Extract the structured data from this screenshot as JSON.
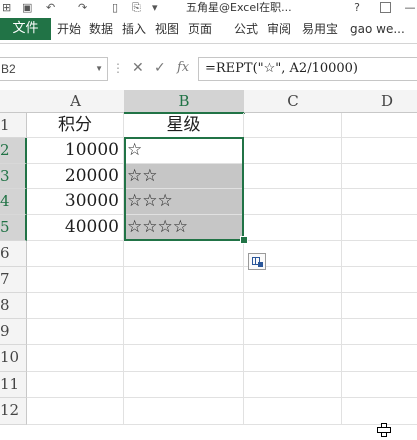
{
  "window": {
    "title": "五角星@Excel在职...",
    "help": "?",
    "restore": "⊡",
    "minimize": "—"
  },
  "ribbon": {
    "file_tab": "文件",
    "tabs": [
      "开始",
      "数据",
      "插入",
      "视图",
      "页面",
      "公式",
      "审阅",
      "易用宝",
      "gao we..."
    ]
  },
  "formula_bar": {
    "name_box": "B2",
    "formula": "=REPT(\"☆\", A2/10000)",
    "cancel_icon": "✕",
    "confirm_icon": "✓",
    "fx_icon": "fx"
  },
  "sheet": {
    "columns": [
      "A",
      "B",
      "C",
      "D"
    ],
    "rows": [
      "1",
      "2",
      "3",
      "4",
      "5",
      "6",
      "7",
      "8",
      "9",
      "10",
      "11",
      "12"
    ],
    "header_row": {
      "A": "积分",
      "B": "星级"
    },
    "data": [
      {
        "score": "10000",
        "stars": "☆"
      },
      {
        "score": "20000",
        "stars": "☆☆"
      },
      {
        "score": "30000",
        "stars": "☆☆☆"
      },
      {
        "score": "40000",
        "stars": "☆☆☆☆"
      }
    ],
    "selected_column": "B",
    "active_cell": "B2"
  },
  "colors": {
    "excel_green": "#217346",
    "selection_gray": "#c6c6c6"
  }
}
